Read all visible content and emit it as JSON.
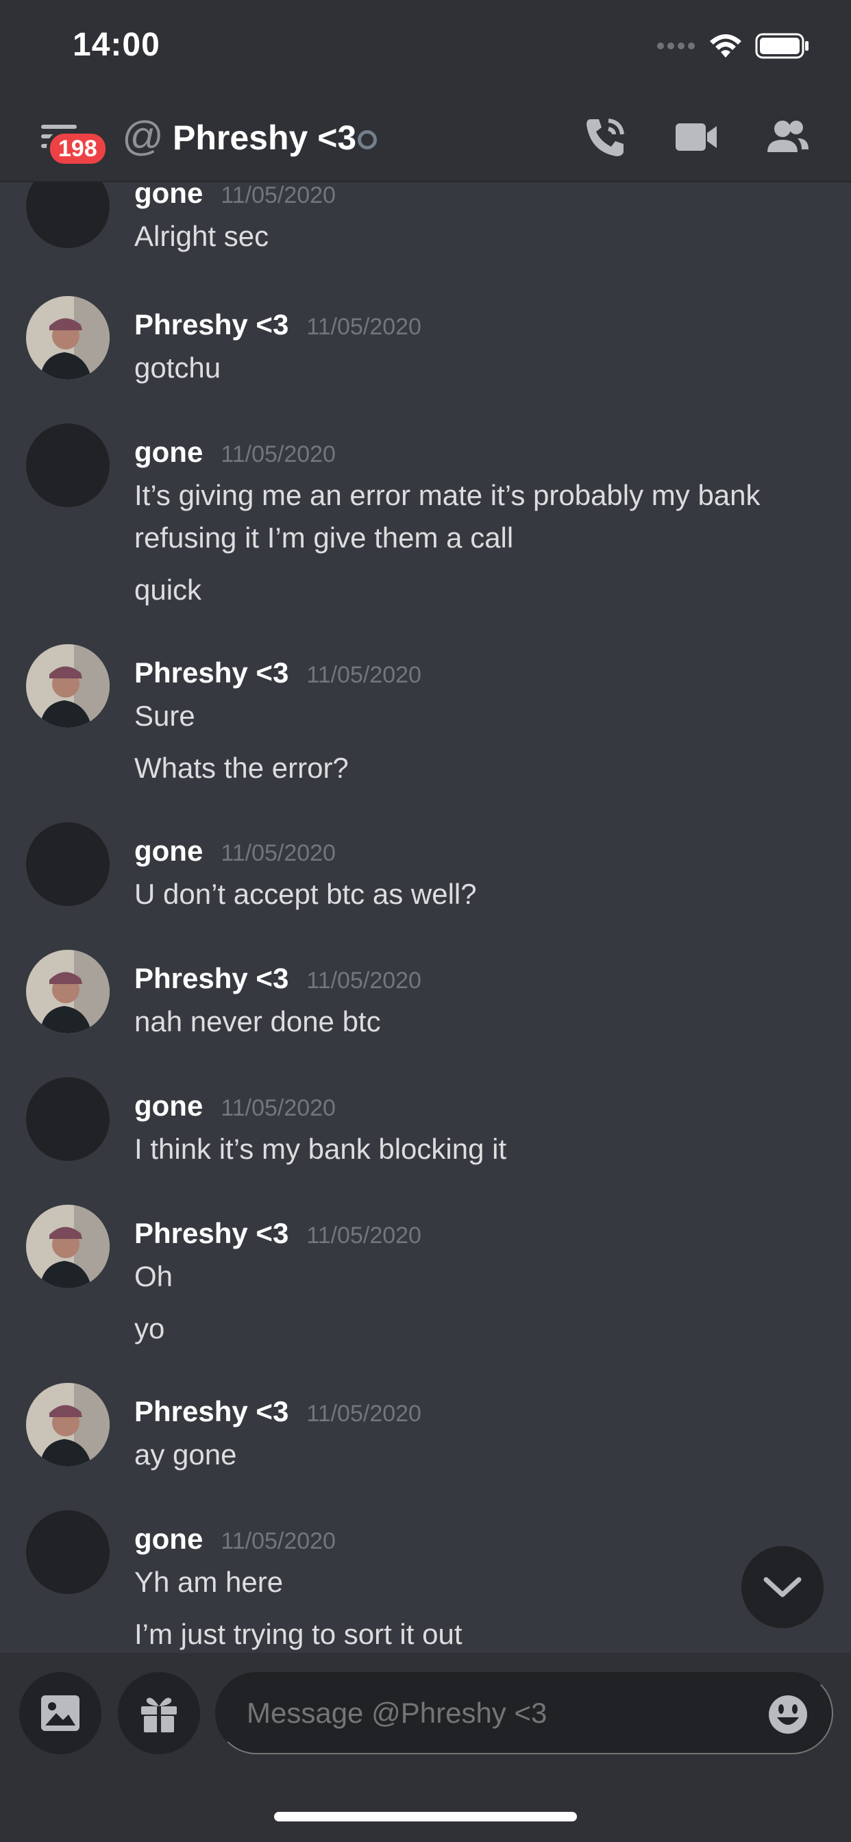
{
  "status_bar": {
    "time": "14:00",
    "icons": [
      "signal-dots-icon",
      "wifi-icon",
      "battery-icon"
    ]
  },
  "header": {
    "notification_badge": "198",
    "at_symbol": "@",
    "title": "Phreshy <3",
    "icons": [
      "hamburger-icon",
      "at-icon",
      "call-icon",
      "video-icon",
      "members-icon"
    ]
  },
  "users": {
    "gone": {
      "name": "gone",
      "avatar": "dark-circle"
    },
    "phreshy": {
      "name": "Phreshy <3",
      "avatar": "photo"
    }
  },
  "messages": [
    {
      "author": "gone",
      "timestamp": "11/05/2020",
      "lines": [
        "Alright sec"
      ]
    },
    {
      "author": "Phreshy <3",
      "timestamp": "11/05/2020",
      "lines": [
        "gotchu"
      ]
    },
    {
      "author": "gone",
      "timestamp": "11/05/2020",
      "lines": [
        "It’s giving me an error mate it’s probably my bank",
        "refusing it I’m give them a call",
        "quick"
      ]
    },
    {
      "author": "Phreshy <3",
      "timestamp": "11/05/2020",
      "lines": [
        "Sure",
        "Whats the error?"
      ]
    },
    {
      "author": "gone",
      "timestamp": "11/05/2020",
      "lines": [
        "U don’t accept btc as well?"
      ]
    },
    {
      "author": "Phreshy <3",
      "timestamp": "11/05/2020",
      "lines": [
        "nah never done btc"
      ]
    },
    {
      "author": "gone",
      "timestamp": "11/05/2020",
      "lines": [
        "I think it’s my bank blocking it"
      ]
    },
    {
      "author": "Phreshy <3",
      "timestamp": "11/05/2020",
      "lines": [
        "Oh",
        "yo"
      ]
    },
    {
      "author": "Phreshy <3",
      "timestamp": "11/05/2020",
      "lines": [
        "ay gone"
      ]
    },
    {
      "author": "gone",
      "timestamp": "11/05/2020",
      "lines": [
        "Yh am here",
        "I’m just trying to sort it out"
      ]
    }
  ],
  "composer": {
    "placeholder": "Message @Phreshy <3",
    "icons": [
      "image-icon",
      "gift-icon",
      "emoji-icon"
    ]
  },
  "scroll_button": {
    "icon": "chevron-down-icon"
  },
  "colors": {
    "background": "#36393f",
    "header": "#2f3136",
    "input": "#202225",
    "badge": "#ed4245",
    "timestamp": "#72767d"
  }
}
